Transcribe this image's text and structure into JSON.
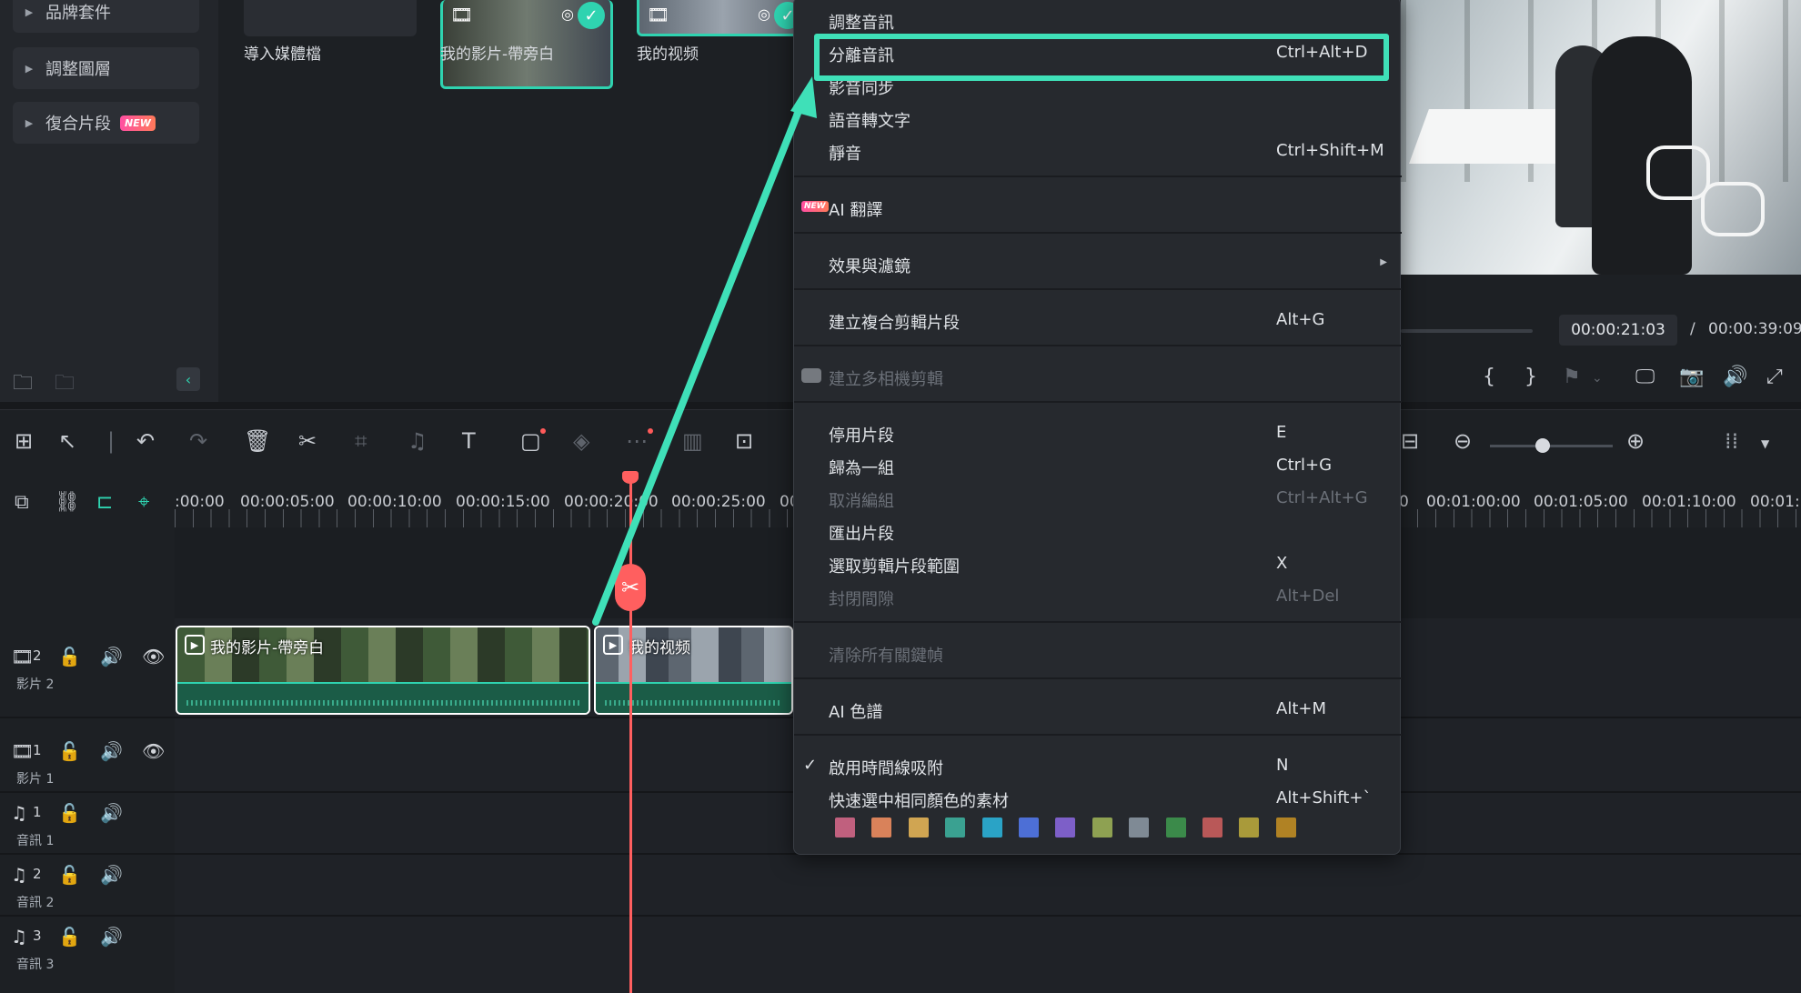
{
  "sidebar": {
    "items": [
      {
        "label": "品牌套件"
      },
      {
        "label": "調整圖層"
      },
      {
        "label": "復合片段",
        "badge": "NEW"
      }
    ]
  },
  "media": {
    "items": [
      {
        "label": "導入媒體檔"
      },
      {
        "label": "我的影片-帶旁白"
      },
      {
        "label": "我的视频"
      }
    ]
  },
  "context_menu": {
    "items": [
      {
        "label": "調整音訊",
        "shortcut": ""
      },
      {
        "label": "分離音訊",
        "shortcut": "Ctrl+Alt+D"
      },
      {
        "label": "影音同步",
        "shortcut": ""
      },
      {
        "label": "語音轉文字",
        "shortcut": ""
      },
      {
        "label": "靜音",
        "shortcut": "Ctrl+Shift+M"
      },
      {
        "label": "AI 翻譯",
        "shortcut": "",
        "badge": "NEW"
      },
      {
        "label": "效果與濾鏡",
        "shortcut": ""
      },
      {
        "label": "建立複合剪輯片段",
        "shortcut": "Alt+G"
      },
      {
        "label": "建立多相機剪輯",
        "shortcut": ""
      },
      {
        "label": "停用片段",
        "shortcut": "E"
      },
      {
        "label": "歸為一組",
        "shortcut": "Ctrl+G"
      },
      {
        "label": "取消編組",
        "shortcut": "Ctrl+Alt+G"
      },
      {
        "label": "匯出片段",
        "shortcut": ""
      },
      {
        "label": "選取剪輯片段範圍",
        "shortcut": "X"
      },
      {
        "label": "封閉間隙",
        "shortcut": "Alt+Del"
      },
      {
        "label": "清除所有關鍵幀",
        "shortcut": ""
      },
      {
        "label": "AI 色譜",
        "shortcut": "Alt+M"
      },
      {
        "label": "啟用時間線吸附",
        "shortcut": "N"
      },
      {
        "label": "快速選中相同顏色的素材",
        "shortcut": "Alt+Shift+`"
      }
    ],
    "check_mark": "✓",
    "swatch_colors": [
      "#c0607e",
      "#d9825a",
      "#d0a552",
      "#3aa191",
      "#2aa3c6",
      "#4d6fd6",
      "#7d5fc8",
      "#8ea152",
      "#7f8a95",
      "#3b8a4a",
      "#b95858",
      "#a99a3a",
      "#b08224"
    ]
  },
  "preview": {
    "current_time": "00:00:21:03",
    "separator": "/",
    "total_time": "00:00:39:09"
  },
  "timeline": {
    "ruler_labels": [
      ":00:00",
      "00:00:05:00",
      "00:00:10:00",
      "00:00:15:00",
      "00:00:20:00",
      "00:00:25:00",
      "00:",
      "0",
      "00:01:00:00",
      "00:01:05:00",
      "00:01:10:00",
      "00:01:1"
    ],
    "tracks": [
      {
        "number": "2",
        "label": "影片 2"
      },
      {
        "number": "1",
        "label": "影片 1"
      },
      {
        "number": "1",
        "label": "音訊 1"
      },
      {
        "number": "2",
        "label": "音訊 2"
      },
      {
        "number": "3",
        "label": "音訊 3"
      }
    ],
    "clips": [
      {
        "title": "我的影片-帶旁白"
      },
      {
        "title": "我的视频"
      }
    ]
  },
  "accent_color": "#3fe0b8",
  "playhead_color": "#ff5f5f"
}
